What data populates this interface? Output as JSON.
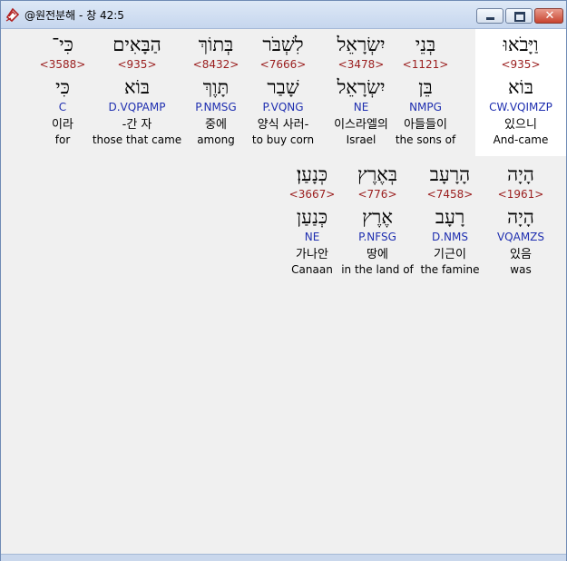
{
  "window": {
    "title": "@원전분해 - 창 42:5"
  },
  "words": [
    {
      "hebrew": "וַיָּבֹאוּ",
      "strong": "<935>",
      "lemma": "בּוֹא",
      "parse": "CW.VQIMZP",
      "korean": "있으니",
      "english": "And-came",
      "highlighted": true
    },
    {
      "hebrew": "בְּנֵי",
      "strong": "<1121>",
      "lemma": "בֵּן",
      "parse": "NMPG",
      "korean": "아들들이",
      "english": "the sons of",
      "highlighted": false
    },
    {
      "hebrew": "יִשְׂרָאֵל",
      "strong": "<3478>",
      "lemma": "יִשְׂרָאֵל",
      "parse": "NE",
      "korean": "이스라엘의",
      "english": "Israel",
      "highlighted": false
    },
    {
      "hebrew": "לִשְׁבֹּר",
      "strong": "<7666>",
      "lemma": "שָׁבַר",
      "parse": "P.VQNG",
      "korean": "양식 사러-",
      "english": "to buy corn",
      "highlighted": false
    },
    {
      "hebrew": "בְּתוֹךְ",
      "strong": "<8432>",
      "lemma": "תָּוֶךְ",
      "parse": "P.NMSG",
      "korean": "중에",
      "english": "among",
      "highlighted": false
    },
    {
      "hebrew": "הַבָּאִים",
      "strong": "<935>",
      "lemma": "בּוֹא",
      "parse": "D.VQPAMP",
      "korean": "-간 자",
      "english": "those that came",
      "highlighted": false
    },
    {
      "hebrew": "כִּי־",
      "strong": "<3588>",
      "lemma": "כִּי",
      "parse": "C",
      "korean": "이라",
      "english": "for",
      "highlighted": false
    },
    {
      "hebrew": "הָיָה",
      "strong": "<1961>",
      "lemma": "הָיָה",
      "parse": "VQAMZS",
      "korean": "있음",
      "english": "was",
      "highlighted": false
    },
    {
      "hebrew": "הָרָעָב",
      "strong": "<7458>",
      "lemma": "רָעָב",
      "parse": "D.NMS",
      "korean": "기근이",
      "english": "the famine",
      "highlighted": false
    },
    {
      "hebrew": "בְּאֶרֶץ",
      "strong": "<776>",
      "lemma": "אֶרֶץ",
      "parse": "P.NFSG",
      "korean": "땅에",
      "english": "in the land of",
      "highlighted": false
    },
    {
      "hebrew": "כְּנָעַן׃",
      "strong": "<3667>",
      "lemma": "כְּנַעַן",
      "parse": "NE",
      "korean": "가나안",
      "english": "Canaan",
      "highlighted": false
    }
  ]
}
